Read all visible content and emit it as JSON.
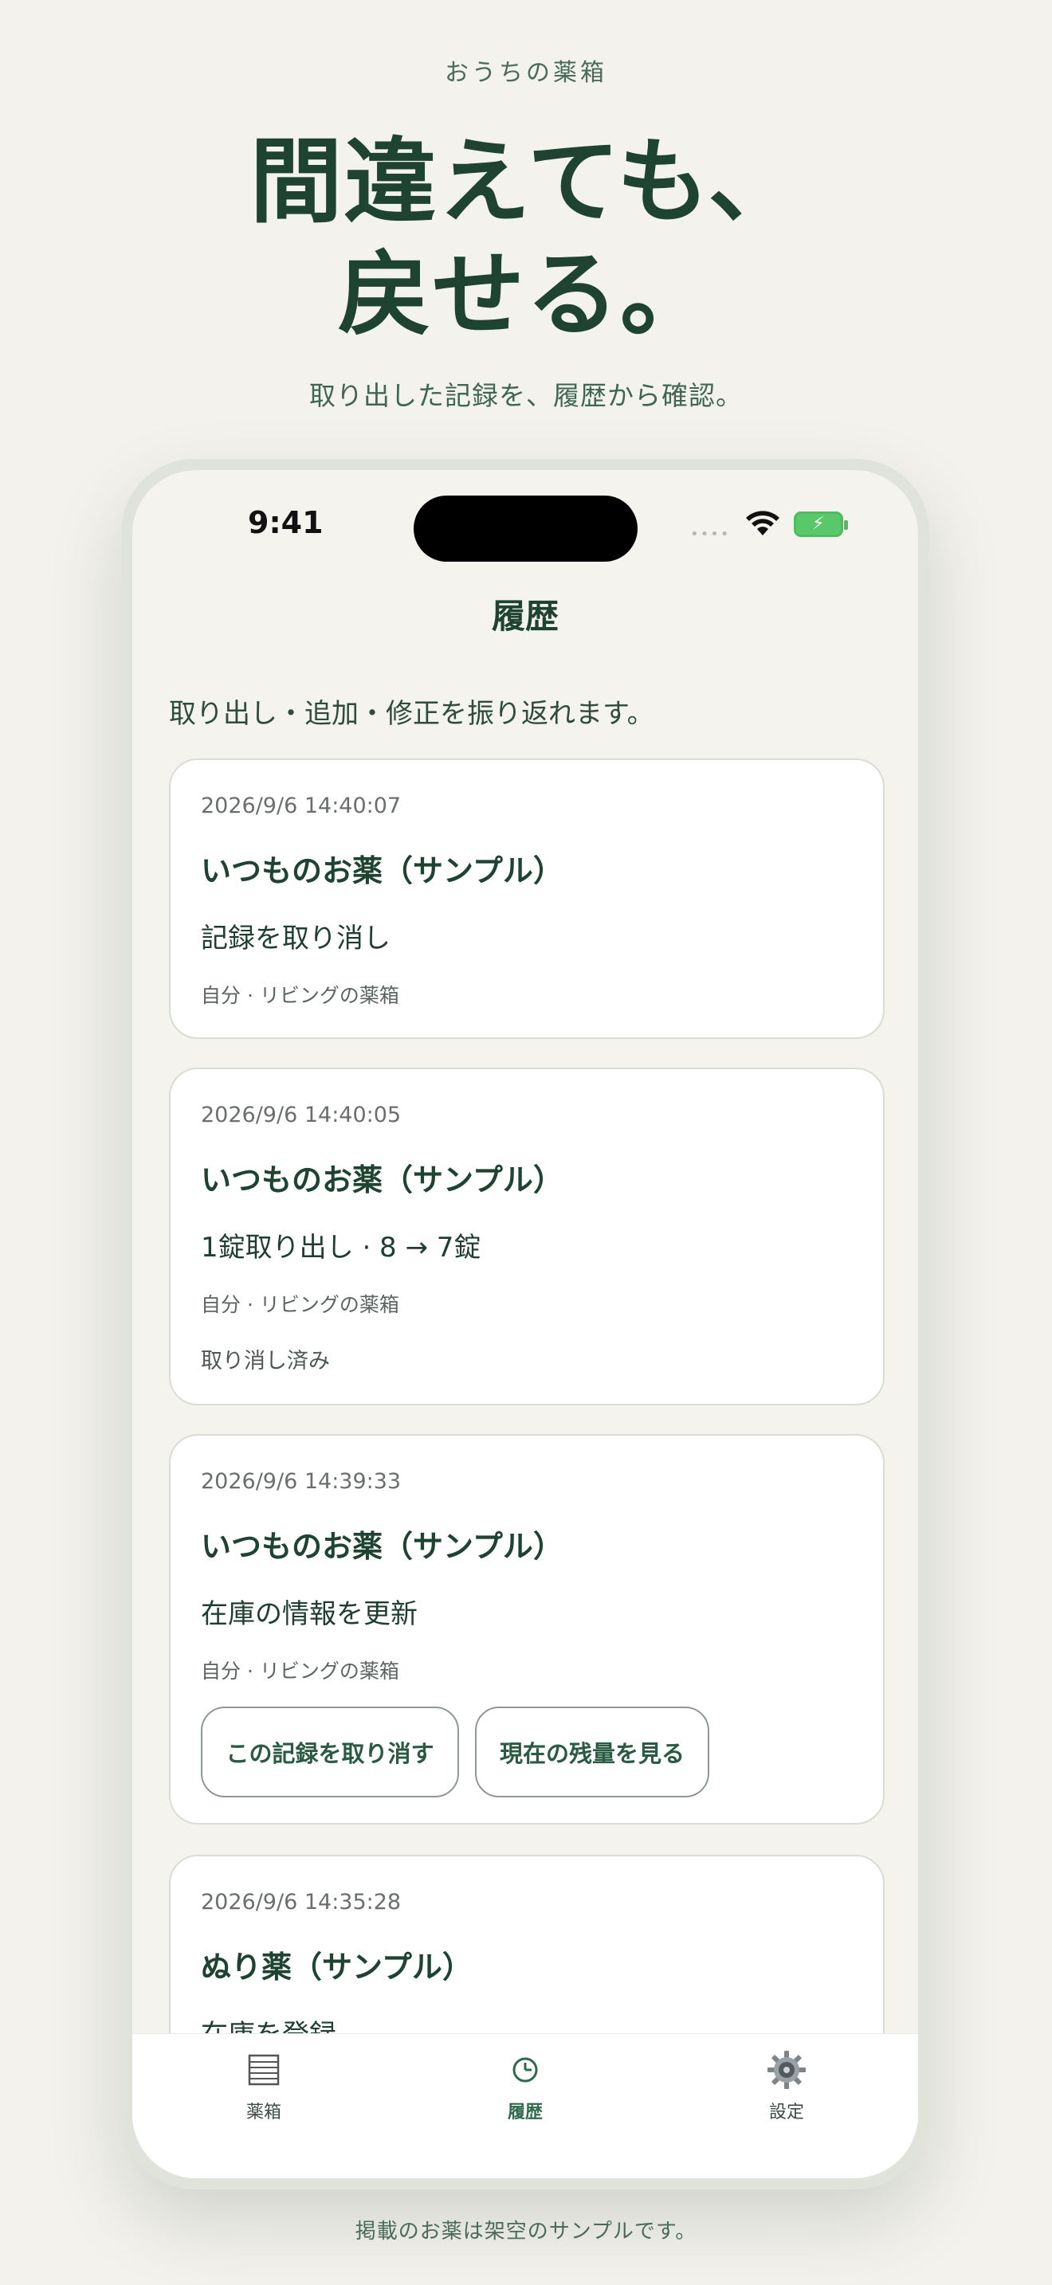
{
  "promo": {
    "brand": "おうちの薬箱",
    "headline_line1": "間違えても、",
    "headline_line2": "戻せる。",
    "subheadline": "取り出した記録を、履歴から確認。",
    "footnote": "掲載のお薬は架空のサンプルです。"
  },
  "status_bar": {
    "time": "9:41",
    "signal": "••••",
    "battery_color": "#58c86a"
  },
  "screen": {
    "title": "履歴",
    "intro": "取り出し・追加・修正を振り返れます。"
  },
  "history": [
    {
      "timestamp": "2026/9/6 14:40:07",
      "medicine": "いつものお薬（サンプル）",
      "action": "記録を取り消し",
      "meta": "自分 · リビングの薬箱"
    },
    {
      "timestamp": "2026/9/6 14:40:05",
      "medicine": "いつものお薬（サンプル）",
      "action": "1錠取り出し · 8 → 7錠",
      "meta": "自分 · リビングの薬箱",
      "status": "取り消し済み"
    },
    {
      "timestamp": "2026/9/6 14:39:33",
      "medicine": "いつものお薬（サンプル）",
      "action": "在庫の情報を更新",
      "meta": "自分 · リビングの薬箱",
      "buttons": {
        "undo": "この記録を取り消す",
        "view_stock": "現在の残量を見る"
      }
    },
    {
      "timestamp": "2026/9/6 14:35:28",
      "medicine": "ぬり薬（サンプル）",
      "action": "在庫を登録"
    }
  ],
  "tabbar": {
    "items": [
      {
        "label": "薬箱",
        "icon": "medicine-box-icon"
      },
      {
        "label": "履歴",
        "icon": "clock-icon",
        "active": true
      },
      {
        "label": "設定",
        "icon": "gear-icon"
      }
    ],
    "accent_color": "#2f6a4c"
  }
}
